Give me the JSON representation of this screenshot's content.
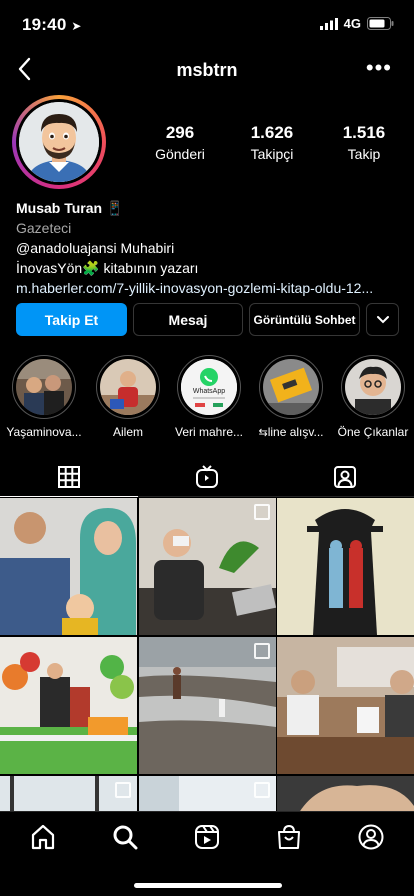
{
  "status": {
    "time": "19:40",
    "network": "4G"
  },
  "header": {
    "username": "msbtrn"
  },
  "profile": {
    "stats": [
      {
        "value": "296",
        "label": "Gönderi"
      },
      {
        "value": "1.626",
        "label": "Takipçi"
      },
      {
        "value": "1.516",
        "label": "Takip"
      }
    ],
    "name": "Musab Turan",
    "category": "Gazeteci",
    "bio_line1": "@anadoluajansi Muhabiri",
    "bio_line2_a": "İnovasYön",
    "bio_line2_b": " kitabının yazarı",
    "link": "m.haberler.com/7-yillik-inovasyon-gozlemi-kitap-oldu-12..."
  },
  "buttons": {
    "follow": "Takip Et",
    "message": "Mesaj",
    "video_chat": "Görüntülü Sohbet"
  },
  "highlights": [
    {
      "label": "Yaşaminova..."
    },
    {
      "label": "Ailem"
    },
    {
      "label": "Veri mahre..."
    },
    {
      "label": "line alışv..."
    },
    {
      "label": "Öne Çıkanlar"
    }
  ],
  "highlight_texts": {
    "whatsapp": "WhatsApp"
  },
  "tabs": [
    "grid-icon",
    "igtv-icon",
    "tagged-icon"
  ],
  "nav": [
    "home-icon",
    "search-icon",
    "reels-icon",
    "shop-icon",
    "profile-icon"
  ],
  "colors": {
    "accent": "#0095f6",
    "background": "#000000",
    "secondary_text": "#a8a8a8"
  }
}
